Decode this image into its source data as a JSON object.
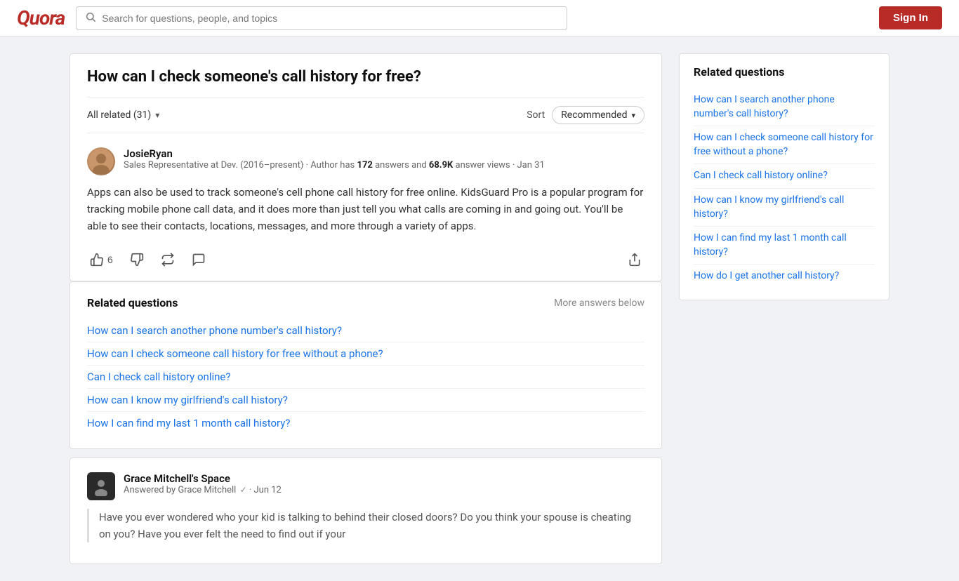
{
  "header": {
    "logo": "Quora",
    "search_placeholder": "Search for questions, people, and topics",
    "sign_in_label": "Sign In"
  },
  "question": {
    "title": "How can I check someone's call history for free?"
  },
  "filters": {
    "all_related_label": "All related (31)",
    "sort_label": "Sort",
    "recommended_label": "Recommended"
  },
  "first_answer": {
    "author_name": "JosieRyan",
    "author_meta": "Sales Representative at Dev. (2016–present) · Author has",
    "answers_count": "172",
    "answers_label": "answers and",
    "views_count": "68.9K",
    "views_label": "answer views ·",
    "date": "Jan 31",
    "text": "Apps can also be used to track someone's cell phone call history for free online. KidsGuard Pro is a popular program for tracking mobile phone call data, and it does more than just tell you what calls are coming in and going out. You'll be able to see their contacts, locations, messages, and more through a variety of apps.",
    "upvote_count": "6"
  },
  "related_in_main": {
    "title": "Related questions",
    "more_answers": "More answers below",
    "links": [
      "How can I search another phone number's call history?",
      "How can I check someone call history for free without a phone?",
      "Can I check call history online?",
      "How can I know my girlfriend's call history?",
      "How I can find my last 1 month call history?"
    ]
  },
  "second_answer": {
    "author_name": "Grace Mitchell's Space",
    "answered_by": "Answered by Grace Mitchell",
    "verified": true,
    "date": "Jun 12",
    "text": "Have you ever wondered who your kid is talking to behind their closed doors? Do you think your spouse is cheating on you? Have you ever felt the need to find out if your"
  },
  "sidebar": {
    "title": "Related questions",
    "links": [
      "How can I search another phone number's call history?",
      "How can I check someone call history for free without a phone?",
      "Can I check call history online?",
      "How can I know my girlfriend's call history?",
      "How I can find my last 1 month call history?",
      "How do I get another call history?"
    ]
  }
}
